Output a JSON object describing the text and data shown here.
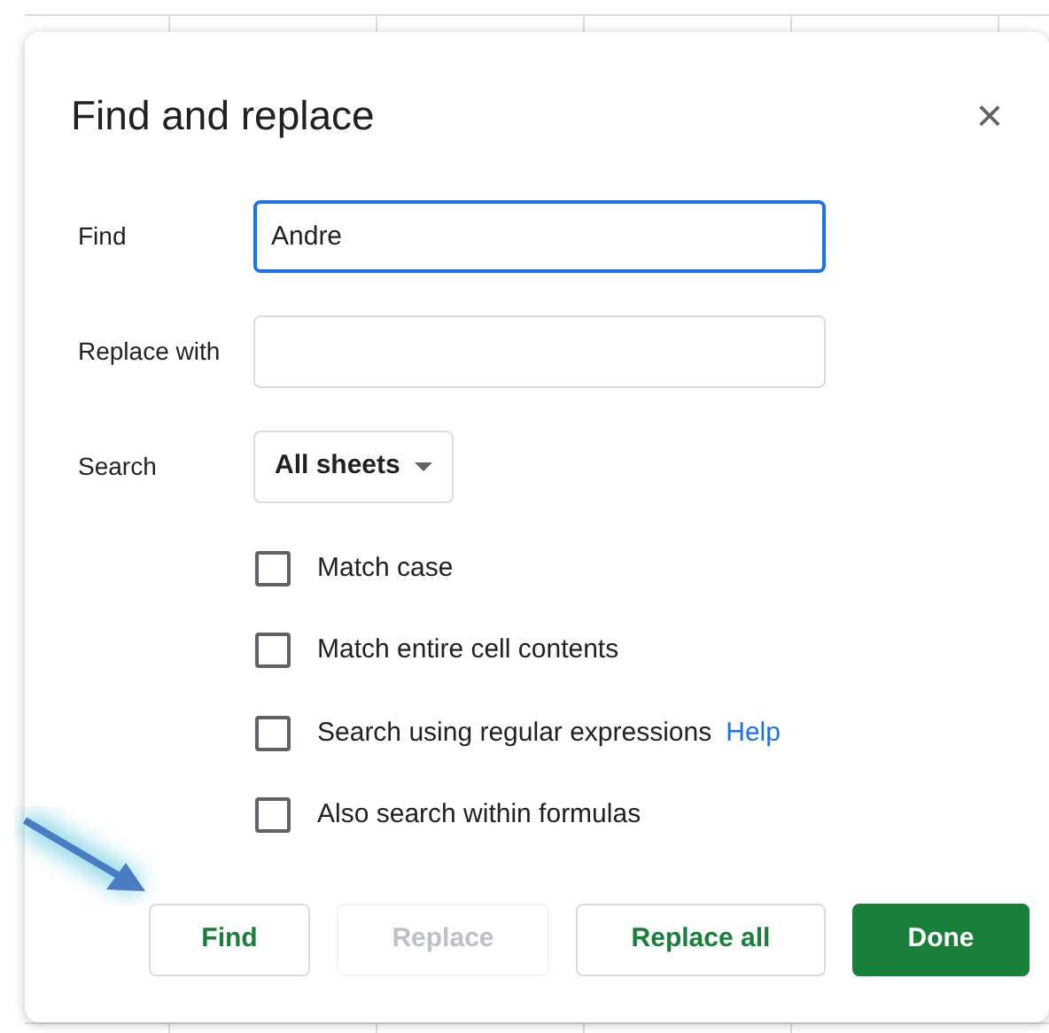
{
  "dialog": {
    "title": "Find and replace",
    "close_label": "×"
  },
  "fields": [
    {
      "kind": "text",
      "label": "Find",
      "value": "Andre",
      "focused": true
    },
    {
      "kind": "text",
      "label": "Replace with",
      "focused": false
    },
    {
      "kind": "dropdown",
      "label": "Search",
      "value": "All sheets"
    }
  ],
  "options": [
    {
      "label": "Match case",
      "checked": false
    },
    {
      "label": "Match entire cell contents",
      "checked": false
    },
    {
      "label": "Search using regular expressions",
      "checked": false,
      "link": "Help"
    },
    {
      "label": "Also search within formulas",
      "checked": false
    }
  ],
  "buttons": [
    {
      "label": "Find",
      "kind": "outline",
      "disabled": false
    },
    {
      "label": "Replace",
      "kind": "outline",
      "disabled": true
    },
    {
      "label": "Replace all",
      "kind": "outline",
      "disabled": false
    },
    {
      "label": "Done",
      "kind": "primary",
      "disabled": false
    }
  ]
}
